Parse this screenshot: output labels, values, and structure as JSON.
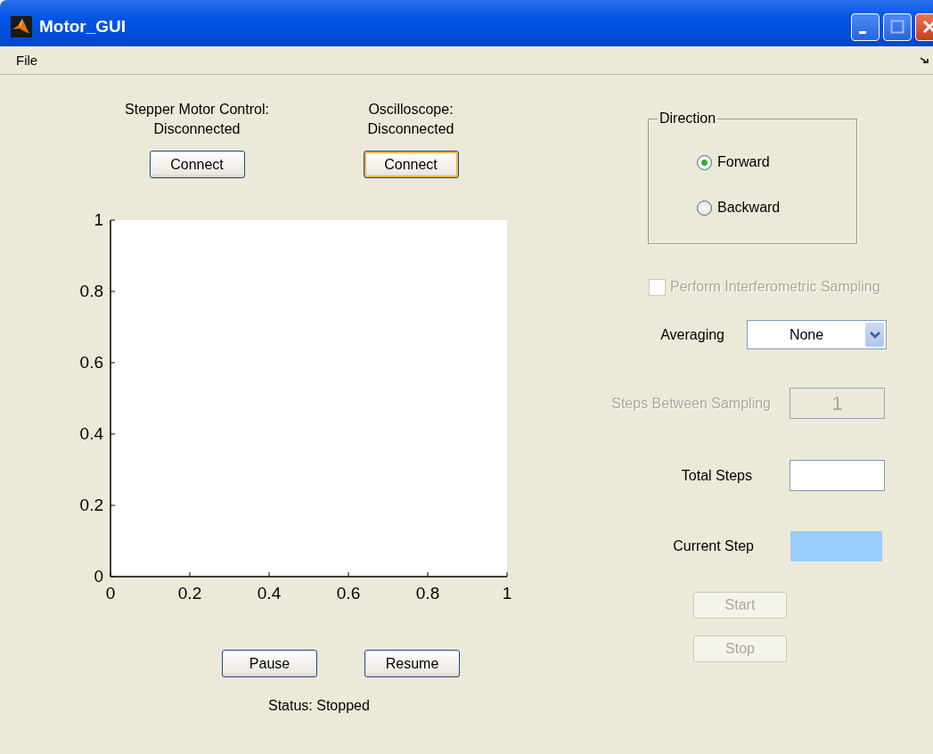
{
  "window": {
    "title": "Motor_GUI"
  },
  "menu": [
    {
      "label": "File"
    }
  ],
  "connections": [
    {
      "label": "Stepper Motor Control:",
      "status": "Disconnected",
      "button": "Connect",
      "focused": false
    },
    {
      "label": "Oscilloscope:",
      "status": "Disconnected",
      "button": "Connect",
      "focused": true
    }
  ],
  "plot": {
    "chart_data": {
      "type": "line",
      "xlim": [
        0,
        1
      ],
      "ylim": [
        0,
        1
      ],
      "xticks": [
        0,
        0.2,
        0.4,
        0.6,
        0.8,
        1
      ],
      "yticks": [
        0,
        0.2,
        0.4,
        0.6,
        0.8,
        1
      ]
    }
  },
  "playback_buttons": [
    {
      "label": "Pause"
    },
    {
      "label": "Resume"
    }
  ],
  "status": "Status: Stopped",
  "direction": {
    "title": "Direction",
    "options": [
      {
        "label": "Forward",
        "selected": true
      },
      {
        "label": "Backward",
        "selected": false
      }
    ]
  },
  "interferometric": {
    "label": "Perform Interferometric Sampling",
    "checked": false,
    "disabled": true
  },
  "averaging": {
    "label": "Averaging",
    "value": "None"
  },
  "steps_between": {
    "label": "Steps Between Sampling",
    "value": "1",
    "disabled": true
  },
  "total_steps": {
    "label": "Total Steps"
  },
  "current_step": {
    "label": "Current Step"
  },
  "actions": [
    {
      "label": "Start",
      "disabled": true
    },
    {
      "label": "Stop",
      "disabled": true
    }
  ]
}
